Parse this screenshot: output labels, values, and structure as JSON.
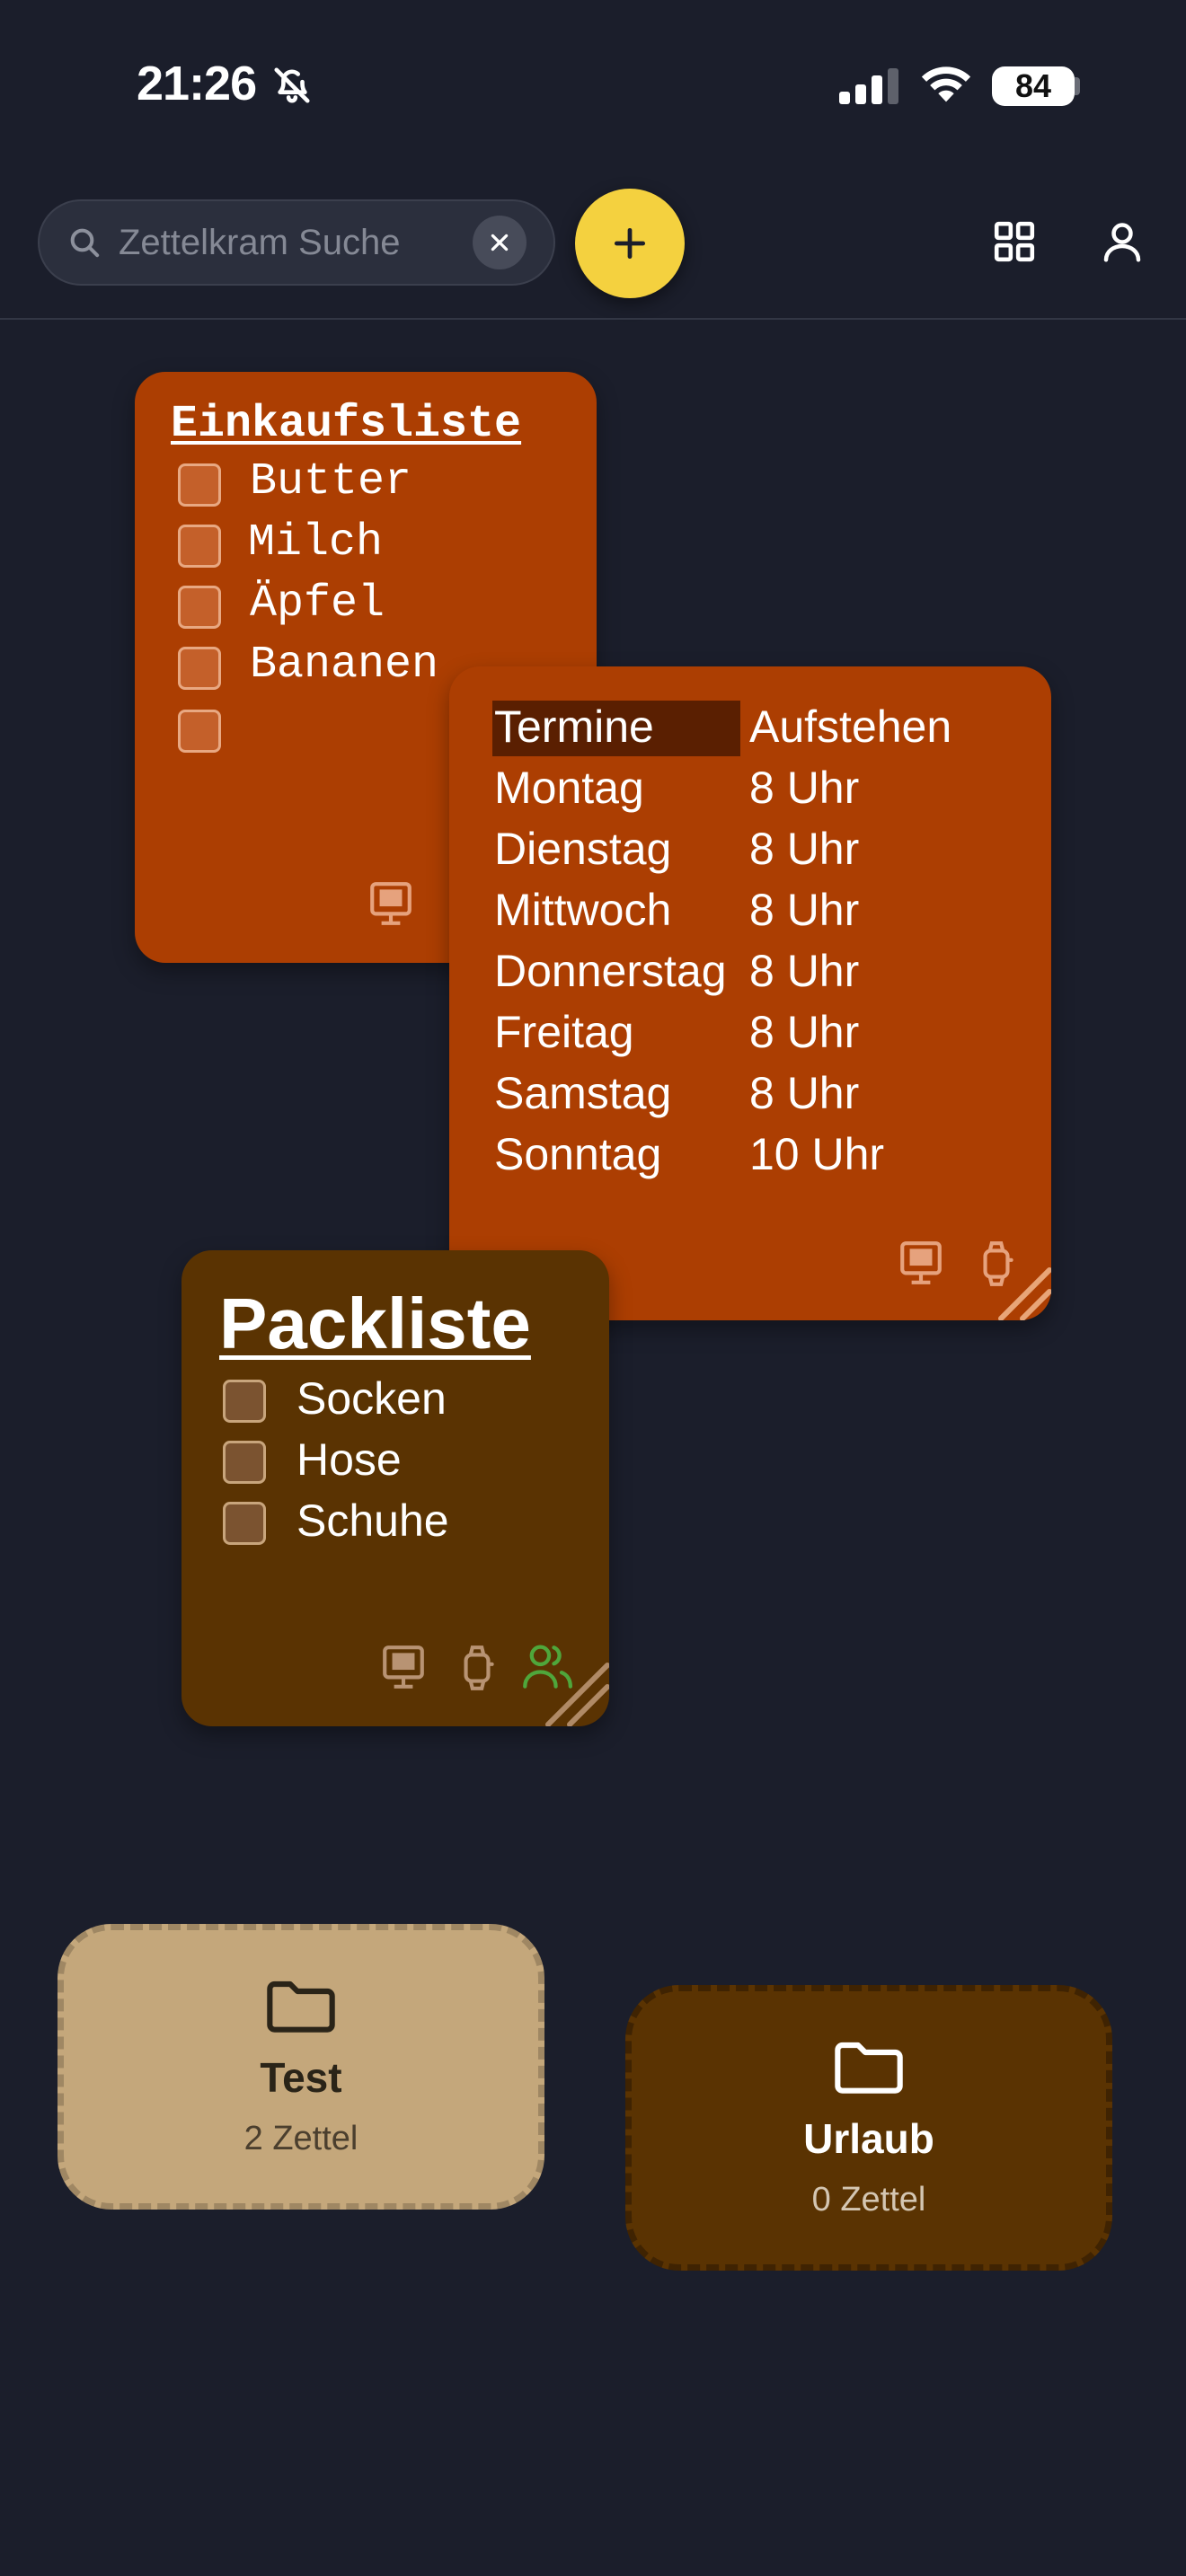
{
  "status_bar": {
    "time": "21:26",
    "battery": "84",
    "icons": [
      "bell-slash-icon",
      "signal-icon",
      "wifi-icon",
      "battery-icon"
    ]
  },
  "toolbar": {
    "search_placeholder": "Zettelkram Suche",
    "search_value": "",
    "icons": [
      "search-icon",
      "close-icon",
      "plus-icon",
      "grid-icon",
      "user-icon"
    ],
    "accent_color": "#f4d13f"
  },
  "notes": [
    {
      "title": "Einkaufsliste",
      "color": "#ac3e02",
      "items": [
        {
          "label": "Butter",
          "checked": false
        },
        {
          "label": "Milch",
          "checked": false
        },
        {
          "label": "Äpfel",
          "checked": false
        },
        {
          "label": "Bananen",
          "checked": false
        },
        {
          "label": "",
          "checked": false
        }
      ],
      "device_icons": [
        "desktop-icon"
      ]
    },
    {
      "title": "",
      "color": "#ac3e02",
      "table": {
        "headers": [
          "Termine",
          "Aufstehen"
        ],
        "rows": [
          [
            "Montag",
            "8 Uhr"
          ],
          [
            "Dienstag",
            "8 Uhr"
          ],
          [
            "Mittwoch",
            "8 Uhr"
          ],
          [
            "Donnerstag",
            "8 Uhr"
          ],
          [
            "Freitag",
            "8 Uhr"
          ],
          [
            "Samstag",
            "8 Uhr"
          ],
          [
            "Sonntag",
            "10 Uhr"
          ]
        ]
      },
      "device_icons": [
        "desktop-icon",
        "watch-icon"
      ]
    },
    {
      "title": "Packliste",
      "color": "#5a3302",
      "items": [
        {
          "label": "Socken",
          "checked": false
        },
        {
          "label": "Hose",
          "checked": false
        },
        {
          "label": "Schuhe",
          "checked": false
        }
      ],
      "device_icons": [
        "desktop-icon",
        "watch-icon",
        "shared-users-icon"
      ]
    }
  ],
  "folders": [
    {
      "name": "Test",
      "count": "2 Zettel",
      "color": "#c4a77b"
    },
    {
      "name": "Urlaub",
      "count": "0 Zettel",
      "color": "#5a3302"
    }
  ]
}
